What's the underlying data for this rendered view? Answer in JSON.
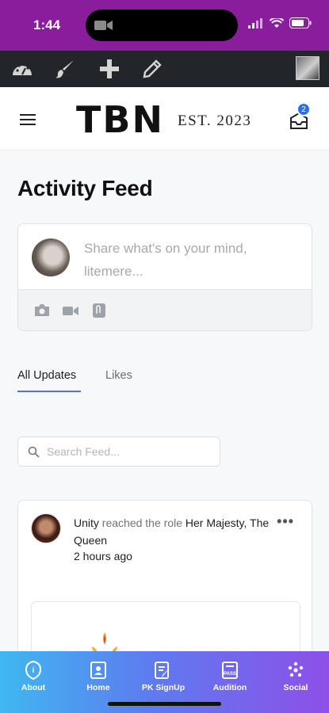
{
  "status_bar": {
    "time": "1:44"
  },
  "header": {
    "logo": "TBN",
    "est": "EST. 2023",
    "notification_count": "2"
  },
  "page": {
    "title": "Activity Feed"
  },
  "composer": {
    "placeholder": "Share what's on your mind, litemere..."
  },
  "tabs": [
    {
      "label": "All Updates",
      "active": true
    },
    {
      "label": "Likes",
      "active": false
    }
  ],
  "search": {
    "placeholder": "Search Feed..."
  },
  "activity": {
    "user": "Unity",
    "action": "reached the role",
    "role": "Her Majesty, The Queen",
    "time": "2 hours ago"
  },
  "bottom_nav": [
    {
      "label": "About",
      "icon": "badge-icon"
    },
    {
      "label": "Home",
      "icon": "home-icon"
    },
    {
      "label": "PK SignUp",
      "icon": "signup-icon"
    },
    {
      "label": "Audition",
      "icon": "pass-icon"
    },
    {
      "label": "Social",
      "icon": "social-icon"
    }
  ],
  "colors": {
    "status_bar": "#8a1d9c",
    "toolbar": "#22262b",
    "accent": "#5a72e0",
    "badge": "#2a6ef5"
  }
}
